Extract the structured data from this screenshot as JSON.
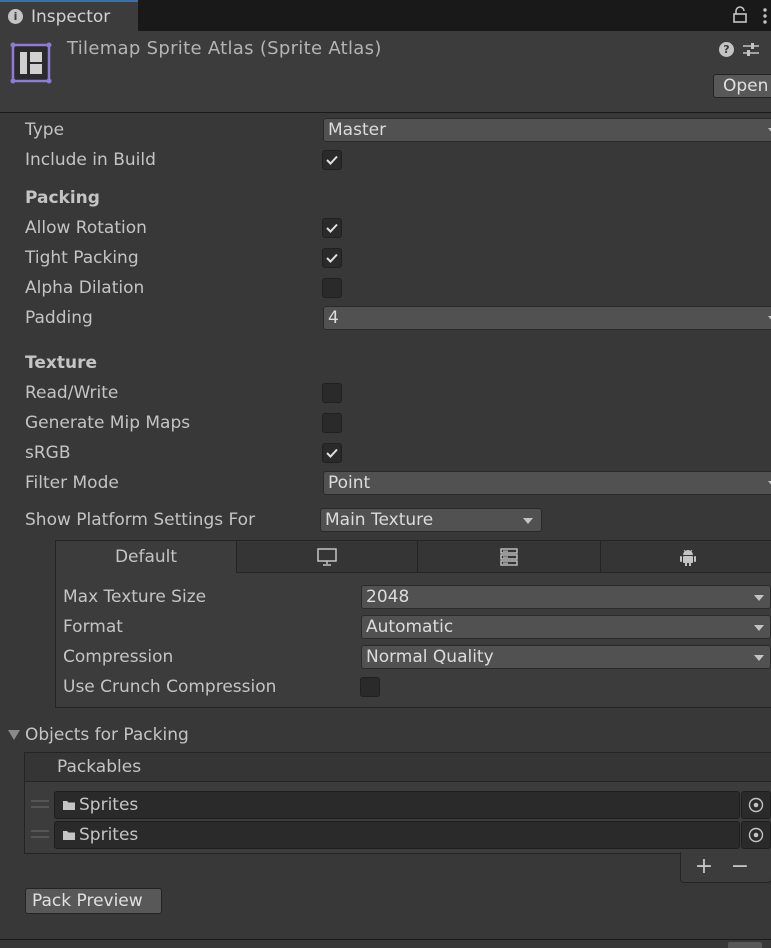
{
  "tab": {
    "title": "Inspector",
    "icon": "info-icon"
  },
  "header": {
    "title": "Tilemap Sprite Atlas (Sprite Atlas)",
    "open_label": "Open"
  },
  "fields": {
    "type": {
      "label": "Type",
      "value": "Master"
    },
    "include_in_build": {
      "label": "Include in Build",
      "checked": true
    },
    "packing_heading": "Packing",
    "allow_rotation": {
      "label": "Allow Rotation",
      "checked": true
    },
    "tight_packing": {
      "label": "Tight Packing",
      "checked": true
    },
    "alpha_dilation": {
      "label": "Alpha Dilation",
      "checked": false
    },
    "padding": {
      "label": "Padding",
      "value": "4"
    },
    "texture_heading": "Texture",
    "read_write": {
      "label": "Read/Write",
      "checked": false
    },
    "generate_mip_maps": {
      "label": "Generate Mip Maps",
      "checked": false
    },
    "srgb": {
      "label": "sRGB",
      "checked": true
    },
    "filter_mode": {
      "label": "Filter Mode",
      "value": "Point"
    },
    "show_platform": {
      "label": "Show Platform Settings For",
      "value": "Main Texture"
    }
  },
  "platform": {
    "tabs": [
      {
        "label": "Default",
        "icon": ""
      },
      {
        "label": "",
        "icon": "monitor-icon"
      },
      {
        "label": "",
        "icon": "server-icon"
      },
      {
        "label": "",
        "icon": "android-icon"
      }
    ],
    "max_texture_size": {
      "label": "Max Texture Size",
      "value": "2048"
    },
    "format": {
      "label": "Format",
      "value": "Automatic"
    },
    "compression": {
      "label": "Compression",
      "value": "Normal Quality"
    },
    "use_crunch": {
      "label": "Use Crunch Compression",
      "checked": false
    }
  },
  "objects": {
    "heading": "Objects for Packing",
    "list_header": "Packables",
    "items": [
      {
        "label": "Sprites"
      },
      {
        "label": "Sprites"
      }
    ],
    "add_label": "+",
    "remove_label": "−"
  },
  "pack_preview_label": "Pack Preview"
}
